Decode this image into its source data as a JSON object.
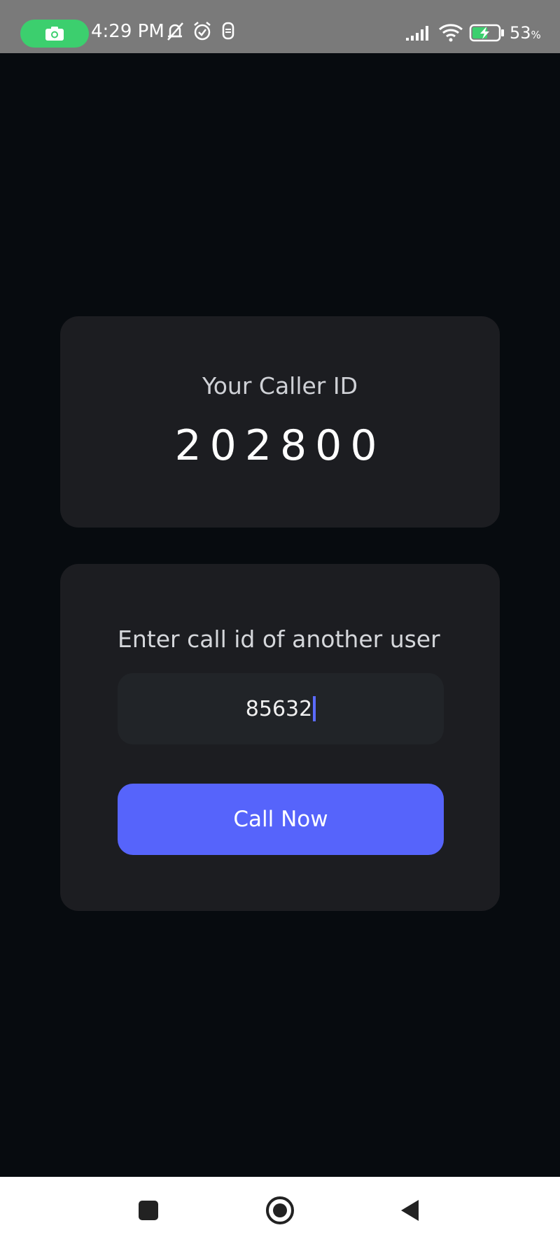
{
  "status_bar": {
    "time": "4:29 PM",
    "battery_percent": "53",
    "battery_unit": "%",
    "icons": [
      "camera-icon",
      "bell-off-icon",
      "alarm-icon",
      "notification-icon",
      "signal-icon",
      "wifi-icon",
      "battery-charging-icon"
    ]
  },
  "caller_card": {
    "label": "Your Caller ID",
    "caller_id": "202800"
  },
  "call_card": {
    "label": "Enter call id of another user",
    "input_value": "85632",
    "button_label": "Call Now"
  },
  "colors": {
    "background": "#070b0f",
    "card": "#1c1d21",
    "input": "#212428",
    "accent": "#5664fb",
    "status_pill": "#3ccf6e"
  },
  "nav_bar": {
    "icons": [
      "recents-square-icon",
      "home-circle-icon",
      "back-triangle-icon"
    ]
  }
}
